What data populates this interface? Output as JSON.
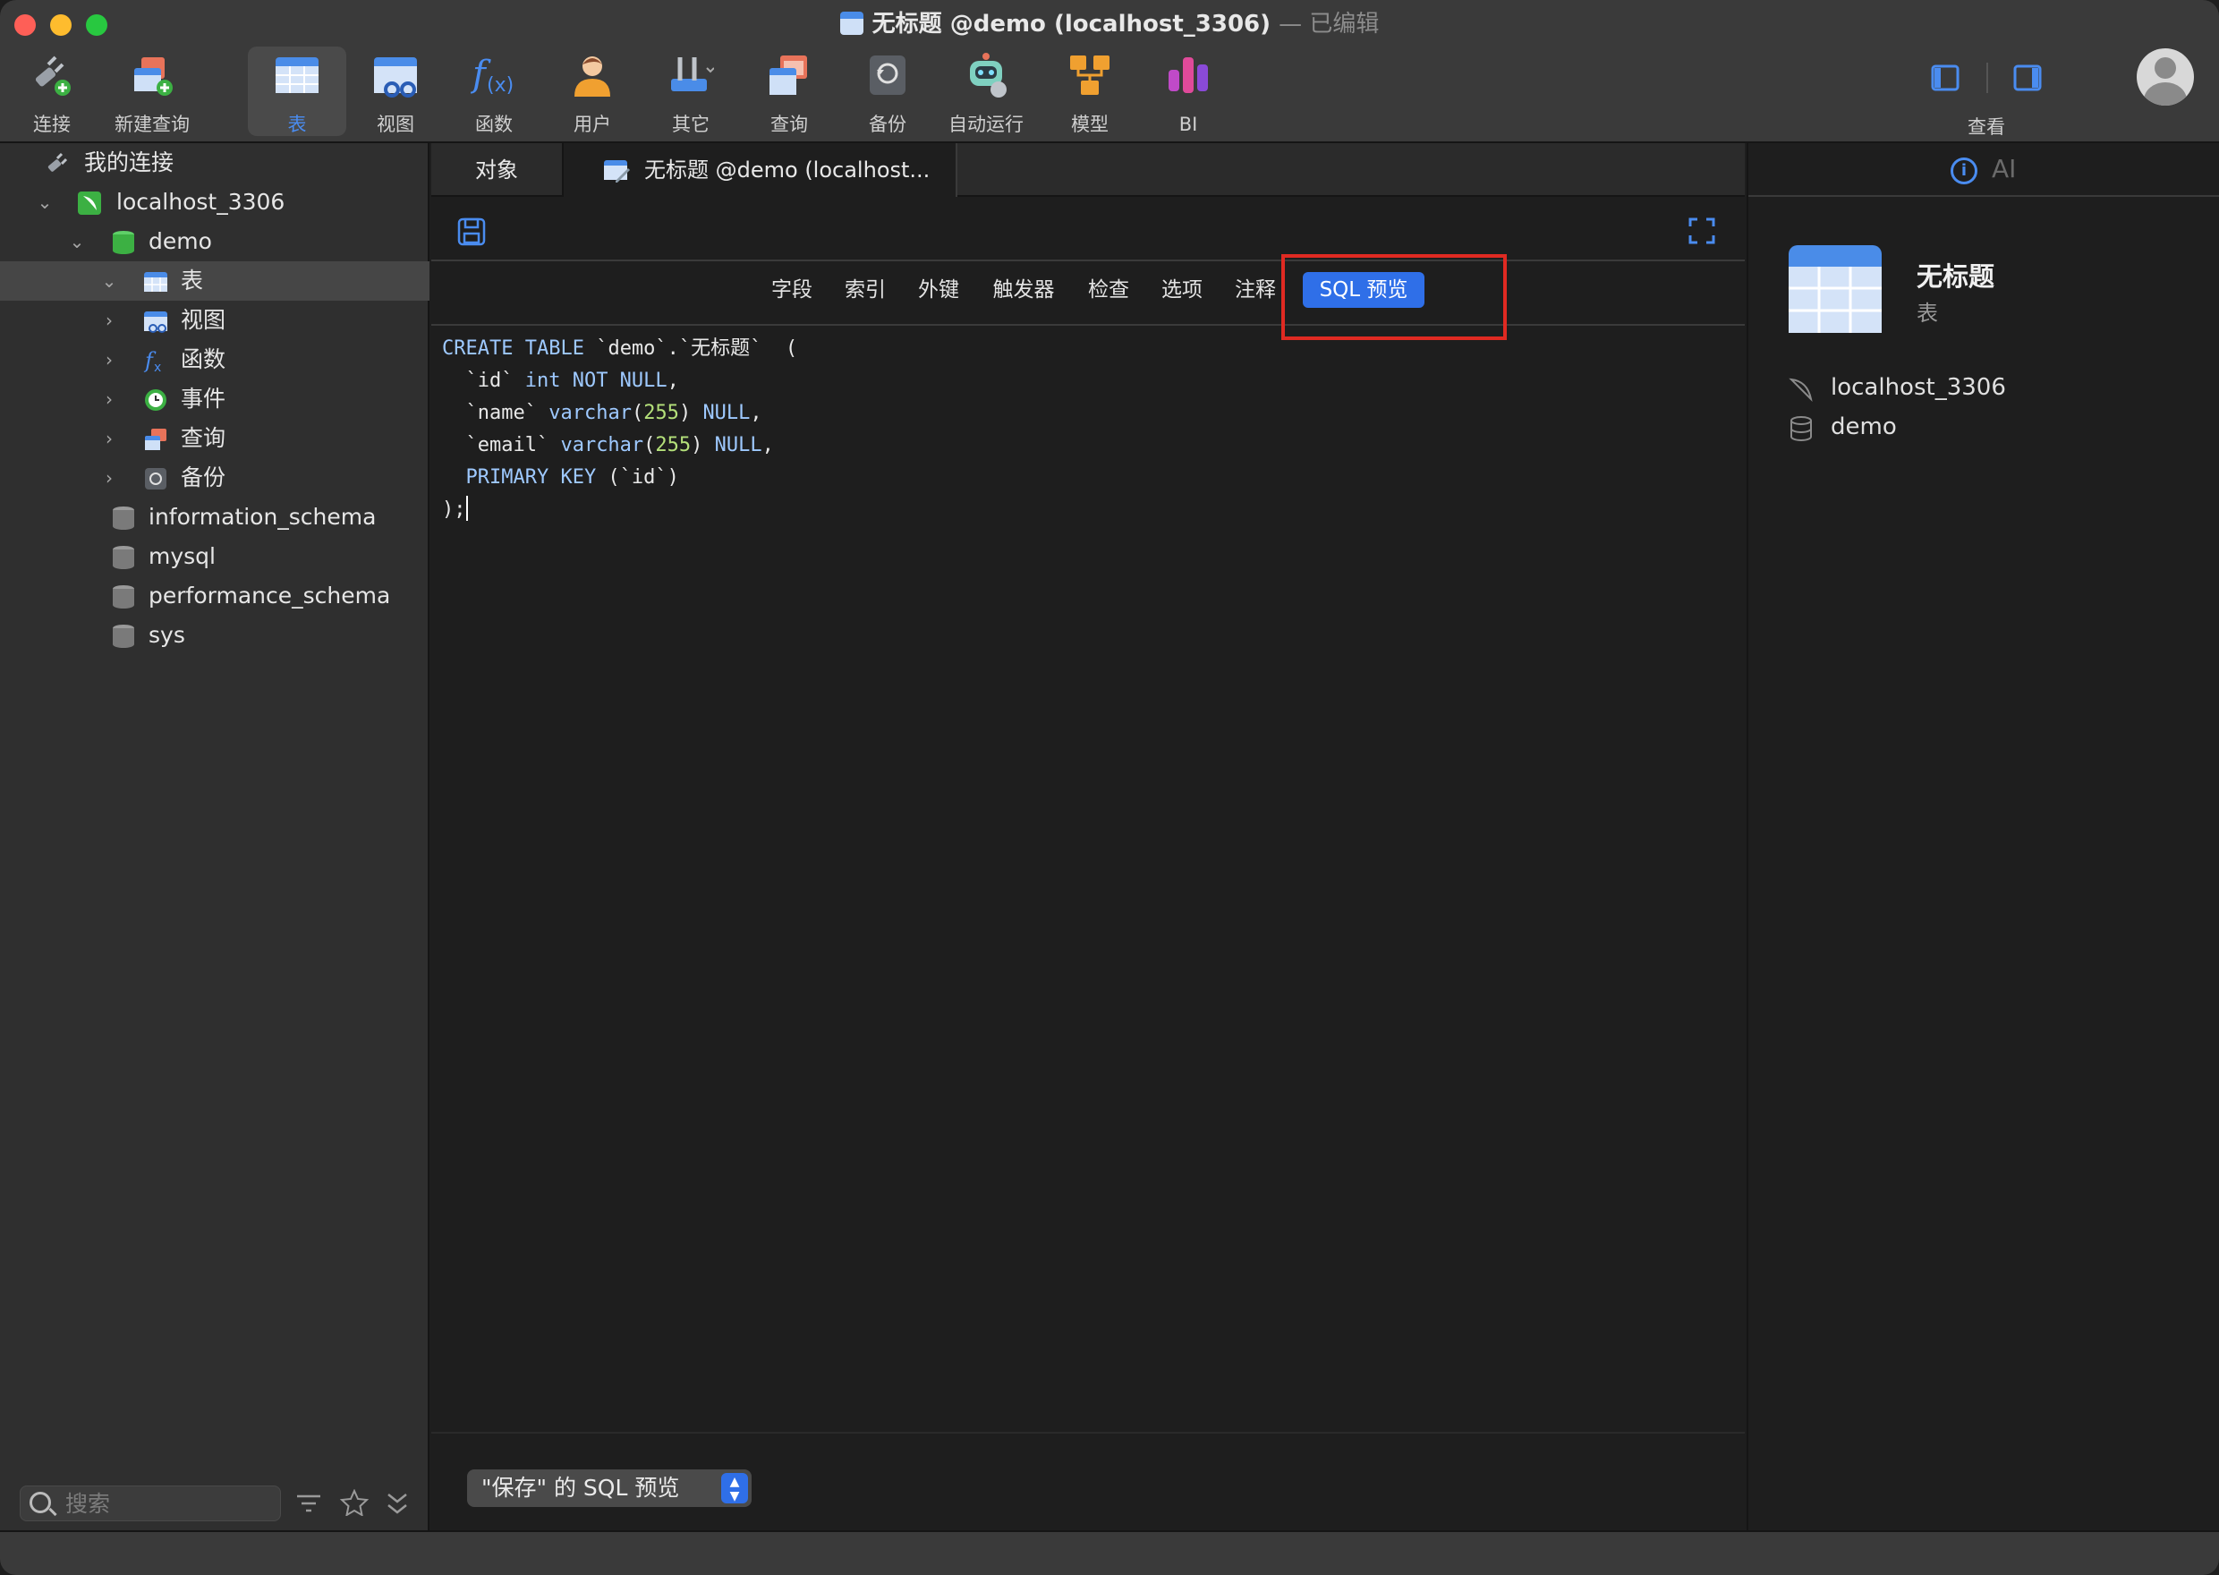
{
  "window": {
    "title": "无标题 @demo (localhost_3306)",
    "edited_suffix": "— 已编辑",
    "traffic_colors": [
      "#fe5f57",
      "#febc2e",
      "#28c840"
    ]
  },
  "toolbar": {
    "items": [
      {
        "label": "连接",
        "icon": "plug-icon"
      },
      {
        "label": "新建查询",
        "icon": "new-query-icon"
      },
      {
        "label": "表",
        "icon": "table-icon",
        "active": true
      },
      {
        "label": "视图",
        "icon": "view-icon"
      },
      {
        "label": "函数",
        "icon": "function-icon"
      },
      {
        "label": "用户",
        "icon": "user-icon"
      },
      {
        "label": "其它",
        "icon": "tools-icon"
      },
      {
        "label": "查询",
        "icon": "query-icon"
      },
      {
        "label": "备份",
        "icon": "backup-icon"
      },
      {
        "label": "自动运行",
        "icon": "robot-icon"
      },
      {
        "label": "模型",
        "icon": "model-icon"
      },
      {
        "label": "BI",
        "icon": "bi-icon"
      }
    ],
    "view_label": "查看",
    "accent": "#4a8cf0"
  },
  "sidebar": {
    "root": "我的连接",
    "connection": "localhost_3306",
    "database": "demo",
    "children": [
      "表",
      "视图",
      "函数",
      "事件",
      "查询",
      "备份"
    ],
    "other_databases": [
      "information_schema",
      "mysql",
      "performance_schema",
      "sys"
    ],
    "search_placeholder": "搜索"
  },
  "tabs": {
    "objects": "对象",
    "editor": "无标题 @demo (localhost..."
  },
  "subtabs": {
    "items": [
      "字段",
      "索引",
      "外键",
      "触发器",
      "检查",
      "选项",
      "注释",
      "SQL 预览"
    ],
    "active": "SQL 预览"
  },
  "code": {
    "l1_kw": "CREATE TABLE",
    "l1_rest": " `demo`.`无标题`  (",
    "l2_name": "  `id` ",
    "l2_kw": "int NOT NULL",
    "l2_end": ",",
    "l3_name": "  `name` ",
    "l3_kw": "varchar",
    "l3_num": "255",
    "l3_kw2": "NULL",
    "l4_name": "  `email` ",
    "l4_kw": "varchar",
    "l4_num": "255",
    "l4_kw2": "NULL",
    "l5_kw": "  PRIMARY KEY",
    "l5_rest": " (`id`)",
    "l6": ");"
  },
  "footer": {
    "preview_select": "\"保存\" 的 SQL 预览"
  },
  "info_panel": {
    "tab_info": "i",
    "tab_ai": "AI",
    "object_name": "无标题",
    "object_type": "表",
    "connection": "localhost_3306",
    "database": "demo"
  }
}
